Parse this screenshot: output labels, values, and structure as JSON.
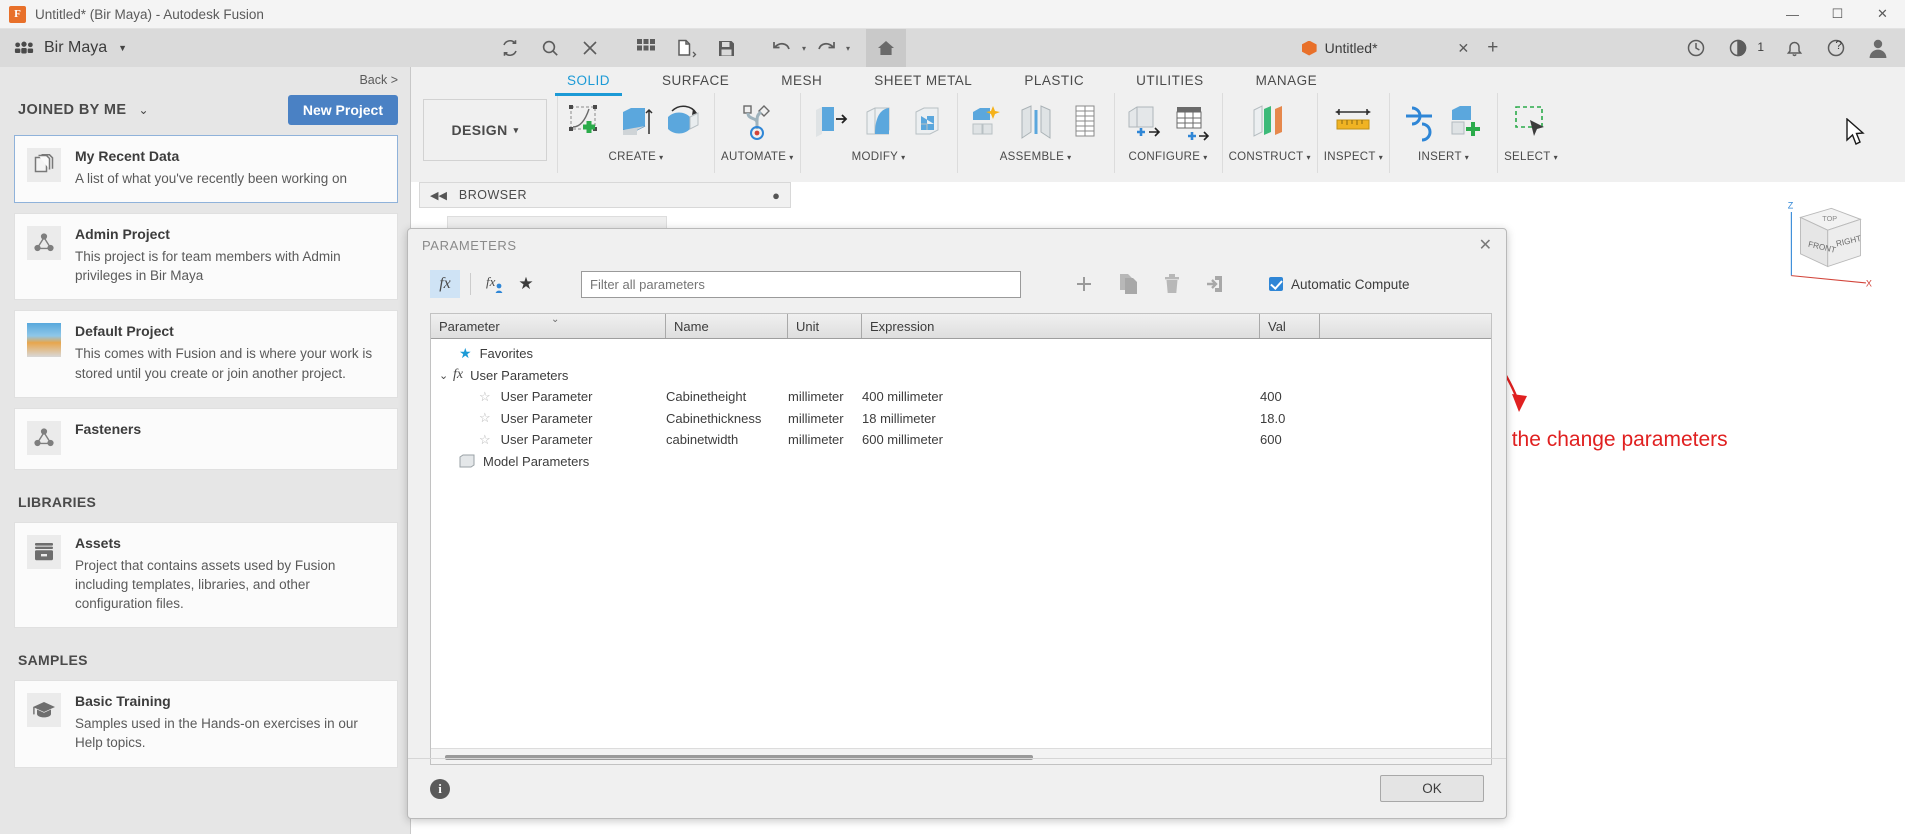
{
  "titlebar": {
    "app_title": "Untitled* (Bir Maya) - Autodesk Fusion",
    "logo_text": "F",
    "minimize": "—",
    "maximize": "☐",
    "close": "✕"
  },
  "globalbar": {
    "team_name": "Bir Maya",
    "team_caret": "▼",
    "tools": [
      {
        "name": "refresh-icon",
        "glyph": "↻"
      },
      {
        "name": "search-icon",
        "glyph": "⚲"
      },
      {
        "name": "close-panel-icon",
        "glyph": "✕"
      },
      {
        "name": "grid-icon",
        "glyph": "▦"
      },
      {
        "name": "new-file-icon",
        "glyph": "❐"
      },
      {
        "name": "save-icon",
        "glyph": "Ὃe"
      },
      {
        "name": "undo-icon",
        "glyph": "↶"
      },
      {
        "name": "redo-icon",
        "glyph": "↷"
      },
      {
        "name": "home-icon",
        "glyph": "⌂"
      }
    ],
    "doc_tab_title": "Untitled*",
    "doc_tab_close": "✕",
    "new_tab": "+",
    "notification_count": "1",
    "help_glyph": "?",
    "bell_glyph": "ὑ4",
    "extension_glyph": "◔"
  },
  "datapanel": {
    "back_link": "Back >",
    "joined_label": "JOINED BY ME",
    "joined_caret": "⌄",
    "new_project_label": "New Project",
    "projects": [
      {
        "name": "My Recent Data",
        "desc": "A list of what you've recently been working on",
        "icon": "documents-icon",
        "selected": true
      },
      {
        "name": "Admin Project",
        "desc": "This project is for team members with Admin privileges in Bir Maya",
        "icon": "project-node-icon",
        "selected": false
      },
      {
        "name": "Default Project",
        "desc": "This comes with Fusion and is where your work is stored until you create or join another project.",
        "icon": "thumbnail-icon",
        "selected": false
      },
      {
        "name": "Fasteners",
        "desc": "",
        "icon": "project-node-icon",
        "selected": false
      }
    ],
    "libraries_label": "LIBRARIES",
    "libraries": [
      {
        "name": "Assets",
        "desc": "Project that contains assets used by Fusion including templates, libraries, and other configuration files.",
        "icon": "archive-icon"
      }
    ],
    "samples_label": "SAMPLES",
    "samples": [
      {
        "name": "Basic Training",
        "desc": "Samples used in the Hands-on exercises in our Help topics.",
        "icon": "graduation-cap-icon"
      }
    ]
  },
  "ribbon": {
    "tabs": [
      {
        "label": "SOLID",
        "active": true
      },
      {
        "label": "SURFACE",
        "active": false
      },
      {
        "label": "MESH",
        "active": false
      },
      {
        "label": "SHEET METAL",
        "active": false
      },
      {
        "label": "PLASTIC",
        "active": false
      },
      {
        "label": "UTILITIES",
        "active": false
      },
      {
        "label": "MANAGE",
        "active": false
      }
    ],
    "workspace_label": "DESIGN",
    "workspace_caret": "▾",
    "groups": [
      {
        "label": "CREATE",
        "caret": "▾",
        "buttons": [
          "create-sketch-icon",
          "extrude-icon",
          "revolve-icon"
        ]
      },
      {
        "label": "AUTOMATE",
        "caret": "▾",
        "buttons": [
          "automate-icon"
        ]
      },
      {
        "label": "MODIFY",
        "caret": "▾",
        "buttons": [
          "press-pull-icon",
          "fillet-icon",
          "shell-icon"
        ]
      },
      {
        "label": "ASSEMBLE",
        "caret": "▾",
        "buttons": [
          "new-component-icon",
          "joint-icon",
          "as-built-joint-icon"
        ]
      },
      {
        "label": "CONFIGURE",
        "caret": "▾",
        "buttons": [
          "configure-icon",
          "configure-table-icon"
        ]
      },
      {
        "label": "CONSTRUCT",
        "caret": "▾",
        "buttons": [
          "offset-plane-icon"
        ]
      },
      {
        "label": "INSPECT",
        "caret": "▾",
        "buttons": [
          "measure-icon"
        ]
      },
      {
        "label": "INSERT",
        "caret": "▾",
        "buttons": [
          "insert-derive-icon",
          "insert-mcmaster-icon"
        ]
      },
      {
        "label": "SELECT",
        "caret": "▾",
        "buttons": [
          "select-window-icon"
        ]
      }
    ]
  },
  "canvas": {
    "browser_label": "BROWSER",
    "browser_collapse": "◀◀",
    "browser_dot": "●",
    "annotation_text": "select the change parameters",
    "viewcube": {
      "front": "FRONT",
      "top": "TOP",
      "right": "RIGHT",
      "axis_z": "Z",
      "axis_x": "X"
    }
  },
  "parameters_dialog": {
    "title": "PARAMETERS",
    "close_glyph": "✕",
    "toolbar": {
      "fx_label": "fx",
      "fx_user_label": "fx",
      "favorite_glyph": "★",
      "add_glyph": "+",
      "duplicate_name": "duplicate-icon",
      "delete_name": "delete-icon",
      "export_name": "export-icon",
      "import_name": "import-icon",
      "automatic_compute_label": "Automatic Compute",
      "automatic_compute_checked": true
    },
    "filter": {
      "placeholder": "Filter all parameters",
      "value": ""
    },
    "columns": [
      "Parameter",
      "Name",
      "Unit",
      "Expression",
      "Val"
    ],
    "groups": [
      {
        "label": "Favorites",
        "icon": "star-filled-icon",
        "expanded": false,
        "rows": []
      },
      {
        "label": "User Parameters",
        "icon": "fx-icon",
        "expanded": true,
        "caret": "⌄",
        "rows": [
          {
            "parameter": "User Parameter",
            "name": "Cabinetheight",
            "unit": "millimeter",
            "expression": "400 millimeter",
            "value": "400"
          },
          {
            "parameter": "User Parameter",
            "name": "Cabinethickness",
            "unit": "millimeter",
            "expression": "18 millimeter",
            "value": "18.0"
          },
          {
            "parameter": "User Parameter",
            "name": "cabinetwidth",
            "unit": "millimeter",
            "expression": "600 millimeter",
            "value": "600"
          }
        ]
      },
      {
        "label": "Model Parameters",
        "icon": "model-icon",
        "expanded": false,
        "rows": []
      }
    ],
    "footer": {
      "info_glyph": "i",
      "ok_label": "OK"
    }
  },
  "colors": {
    "accent_blue": "#1c9ad6",
    "button_blue": "#4a81c4",
    "annotation_red": "#e02020",
    "brand_orange": "#e8702a"
  }
}
